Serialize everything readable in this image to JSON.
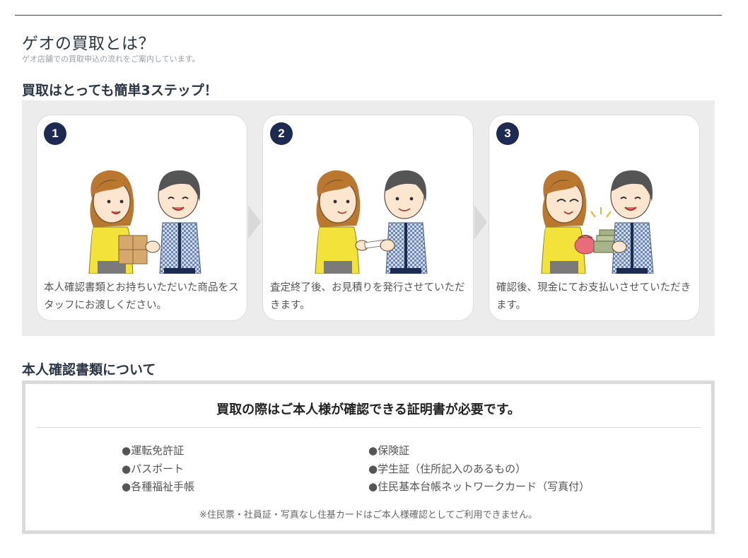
{
  "header": {
    "title": "ゲオの買取とは？",
    "subtitle": "ゲオ店舗での買取申込の流れをご案内しています。"
  },
  "steps": {
    "heading": "買取はとっても簡単3ステップ！",
    "items": [
      {
        "number": "1",
        "text": "本人確認書類とお持ちいただいた商品をスタッフにお渡しください。",
        "illustration": "customer-handing-box-to-staff"
      },
      {
        "number": "2",
        "text": "査定終了後、お見積りを発行させていただきます。",
        "illustration": "staff-handing-estimate-slip"
      },
      {
        "number": "3",
        "text": "確認後、現金にてお支払いさせていただきます。",
        "illustration": "staff-paying-cash"
      }
    ]
  },
  "id_docs": {
    "heading": "本人確認書類について",
    "lead": "買取の際はご本人様が確認できる証明書が必要です。",
    "left_items": [
      "運転免許証",
      "パスポート",
      "各種福祉手帳"
    ],
    "right_items": [
      "保険証",
      "学生証（住所記入のあるもの）",
      "住民基本台帳ネットワークカード（写真付）"
    ],
    "note": "※住民票・社員証・写真なし住基カードはご本人様確認としてご利用できません。"
  },
  "colors": {
    "badge": "#1d2b52",
    "heading": "#2b3543",
    "panel_bg": "#ececec",
    "woman_jacket": "#f3e23a",
    "staff_shirt": "#8fa6c8"
  }
}
